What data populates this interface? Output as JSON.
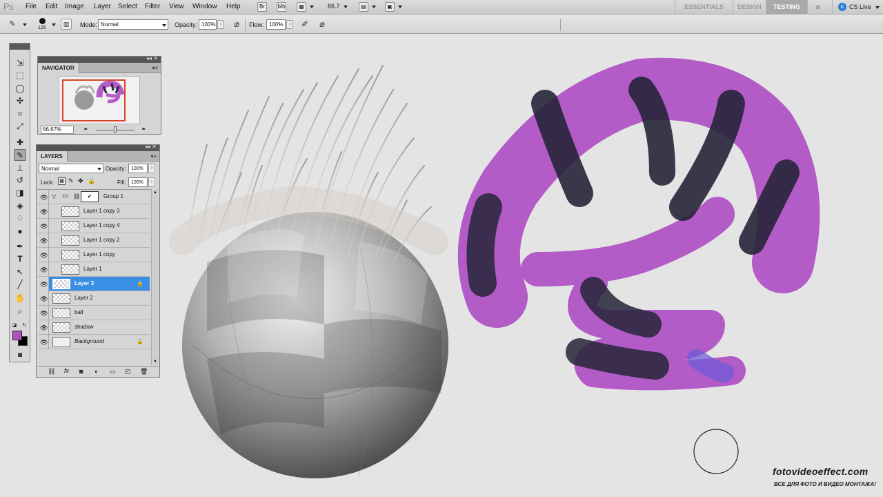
{
  "app": {
    "logo": "Ps"
  },
  "menu": [
    "File",
    "Edit",
    "Image",
    "Layer",
    "Select",
    "Filter",
    "View",
    "Window",
    "Help"
  ],
  "appbar": {
    "btn1": "Br",
    "btn2": "Mb",
    "zoom": "66.7"
  },
  "workspaces": [
    "ESSENTIALS",
    "DESIGN",
    "TESTING"
  ],
  "workspaces_active": "TESTING",
  "cslive": "CS Live",
  "options": {
    "brush_size": "125",
    "mode_label": "Mode:",
    "mode_value": "Normal",
    "opacity_label": "Opacity:",
    "opacity_value": "100%",
    "flow_label": "Flow:",
    "flow_value": "100%"
  },
  "navigator": {
    "tab": "NAVIGATOR",
    "zoom": "66.67%"
  },
  "layers": {
    "tab": "LAYERS",
    "blend_mode": "Normal",
    "opacity_label": "Opacity:",
    "opacity_value": "100%",
    "lock_label": "Lock:",
    "fill_label": "Fill:",
    "fill_value": "100%",
    "items": [
      {
        "name": "Group 1"
      },
      {
        "name": "Layer 1 copy 3"
      },
      {
        "name": "Layer 1 copy 4"
      },
      {
        "name": "Layer 1 copy 2"
      },
      {
        "name": "Layer 1 copy"
      },
      {
        "name": "Layer 1"
      },
      {
        "name": "Layer 3"
      },
      {
        "name": "Layer 2"
      },
      {
        "name": "ball"
      },
      {
        "name": "shadow"
      },
      {
        "name": "Background"
      }
    ]
  },
  "colors": {
    "foreground": "#b24fc4",
    "background": "#000000",
    "selection": "#3a8ee6",
    "purple_stroke": "#b35cc7",
    "dark_stroke": "#262438"
  },
  "watermark": {
    "site": "fotovideoeffect.com",
    "tagline": "ВСЕ ДЛЯ ФОТО И ВИДЕО МОНТАЖА!"
  }
}
